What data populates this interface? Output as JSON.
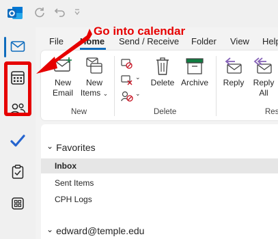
{
  "ribbon_tabs": [
    "File",
    "Home",
    "Send / Receive",
    "Folder",
    "View",
    "Help"
  ],
  "active_tab": "Home",
  "ribbon": {
    "new_email": "New Email",
    "new_email_line1": "New",
    "new_email_line2": "Email",
    "new_items_line1": "New",
    "new_items_line2": "Items",
    "new_group": "New",
    "delete": "Delete",
    "archive": "Archive",
    "delete_group": "Delete",
    "reply": "Reply",
    "reply_all_line1": "Reply",
    "reply_all_line2": "All",
    "respond_group": "Res"
  },
  "folder_pane": {
    "favorites_label": "Favorites",
    "favorites": [
      "Inbox",
      "Sent Items",
      "CPH Logs"
    ],
    "selected_folder": "Inbox",
    "account": "edward@temple.edu"
  },
  "annotation": {
    "text": "Go into calendar",
    "color": "#e60000"
  },
  "icons": {
    "rail": [
      "mail-icon",
      "calendar-icon",
      "people-icon",
      "todo-icon",
      "tasks-icon",
      "apps-icon"
    ],
    "accent": "#0f6cbd"
  }
}
